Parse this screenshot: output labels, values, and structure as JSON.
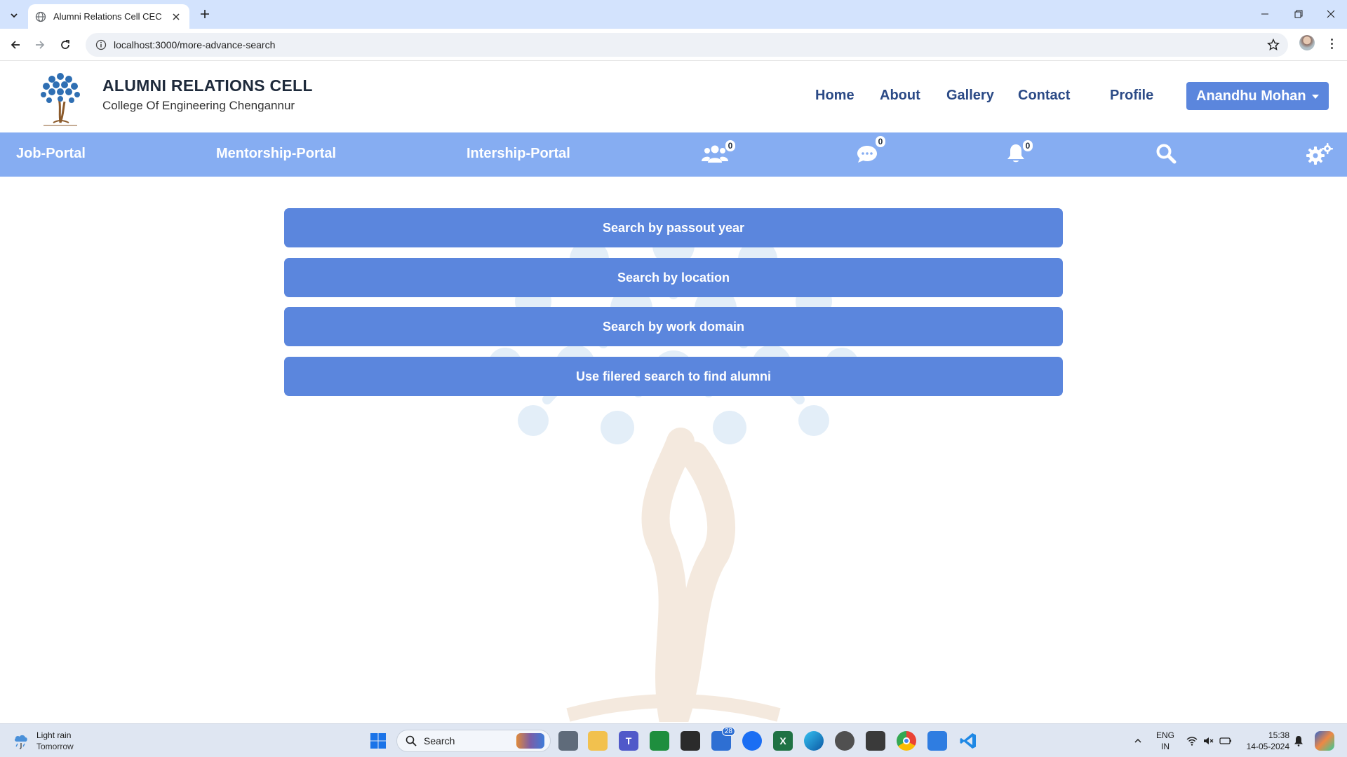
{
  "browser": {
    "tab_title": "Alumni Relations Cell CEC",
    "url": "localhost:3000/more-advance-search"
  },
  "header": {
    "title": "ALUMNI RELATIONS CELL",
    "subtitle": "College Of Engineering Chengannur",
    "nav": [
      "Home",
      "About",
      "Gallery",
      "Contact",
      "Profile"
    ],
    "user_name": "Anandhu Mohan"
  },
  "subnav": {
    "portals": [
      "Job-Portal",
      "Mentorship-Portal",
      "Intership-Portal"
    ],
    "friends_count": "0",
    "messages_count": "0",
    "notifications_count": "0"
  },
  "main": {
    "buttons": [
      "Search by passout year",
      "Search by location",
      "Search by work domain",
      "Use filered search to find alumni"
    ]
  },
  "taskbar": {
    "weather_title": "Light rain",
    "weather_sub": "Tomorrow",
    "search_label": "Search",
    "mail_badge": "28",
    "lang_line1": "ENG",
    "lang_line2": "IN",
    "time": "15:38",
    "date": "14-05-2024"
  },
  "colors": {
    "accent": "#5b86dd",
    "subnav_bg": "#86adf2",
    "nav_text": "#2b4a86",
    "tab_strip": "#d3e3fd"
  }
}
